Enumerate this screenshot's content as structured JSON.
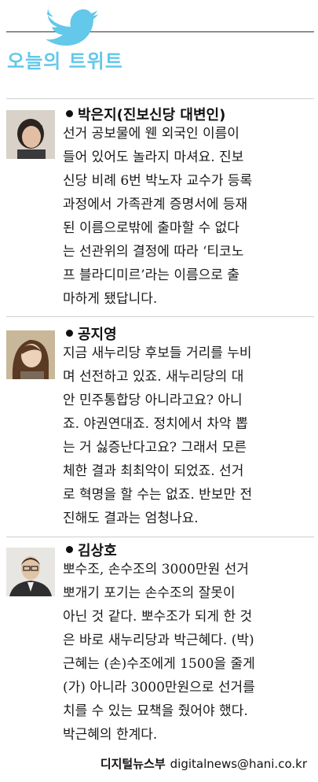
{
  "header": {
    "title": "오늘의 트위트",
    "icon": "twitter-bird-icon",
    "accent_color": "#63c8ea"
  },
  "tweets": [
    {
      "name": "박은지(진보신당 대변인)",
      "lines": [
        "선거 공보물에 웬 외국인 이름이",
        "들어 있어도 놀라지 마셔요. 진보",
        "신당 비례 6번 박노자 교수가 등록",
        "과정에서 가족관계 증명서에 등재",
        "된 이름으로밖에 출마할 수 없다",
        "는 선관위의 결정에 따라 ‘티코노",
        "프 블라디미르’라는 이름으로 출",
        "마하게 됐답니다."
      ]
    },
    {
      "name": "공지영",
      "lines": [
        "지금 새누리당 후보들 거리를 누비",
        "며 선전하고 있죠. 새누리당의 대",
        "안 민주통합당 아니라고요? 아니",
        "죠. 야권연대죠. 정치에서 차악 뽑",
        "는 거 싫증난다고요? 그래서 모른",
        "체한 결과 최최악이 되었죠. 선거",
        "로 혁명을 할 수는 없죠. 반보만 전",
        "진해도 결과는 엄청나요."
      ]
    },
    {
      "name": "김상호",
      "lines": [
        "뽀수조, 손수조의 3000만원 선거",
        "뽀개기 포기는 손수조의 잘못이",
        "아닌 것 같다. 뽀수조가 되게 한 것",
        "은 바로 새누리당과 박근혜다. (박)",
        "근혜는 (손)수조에게 1500을 줄게",
        "(가) 아니라 3000만원으로 선거를",
        "치를 수 있는 묘책을 줬어야 했다.",
        "박근혜의 한계다."
      ]
    }
  ],
  "footer": {
    "desk": "디지털뉴스부",
    "email": "digitalnews@hani.co.kr"
  }
}
